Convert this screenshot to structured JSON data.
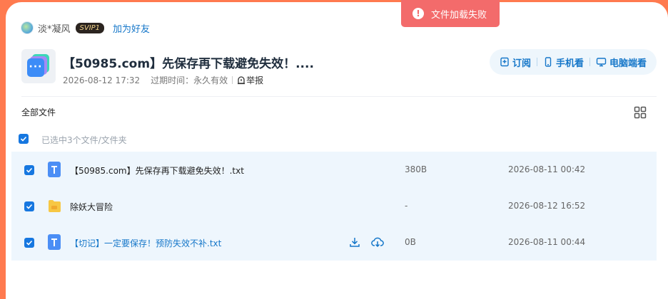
{
  "user": {
    "name": "淡*凝风",
    "vip_badge": "SVIP1",
    "add_friend": "加为好友"
  },
  "share": {
    "title": "【50985.com】先保存再下载避免失效！....",
    "date": "2026-08-12 17:32",
    "expire": "过期时间：永久有效",
    "report": "举报"
  },
  "actions": {
    "subscribe": "订阅",
    "mobile": "手机看",
    "desktop": "电脑端看"
  },
  "toolbar": {
    "all_files": "全部文件",
    "selected_count": "已选中3个文件/文件夹"
  },
  "files": [
    {
      "name": "【50985.com】先保存再下载避免失效！.txt",
      "size": "380B",
      "date": "2026-08-11 00:42",
      "type": "txt",
      "checked": true
    },
    {
      "name": "除妖大冒险",
      "size": "-",
      "date": "2026-08-12 16:52",
      "type": "folder",
      "checked": true
    },
    {
      "name": "【切记】一定要保存！预防失效不补.txt",
      "size": "0B",
      "date": "2026-08-11 00:44",
      "type": "txt",
      "checked": true
    }
  ],
  "toast": {
    "message": "文件加载失败"
  },
  "colors": {
    "accent": "#1677c9",
    "toast": "#f36b6b",
    "background": "#ff7a4f",
    "row_highlight": "#eef6fd"
  }
}
